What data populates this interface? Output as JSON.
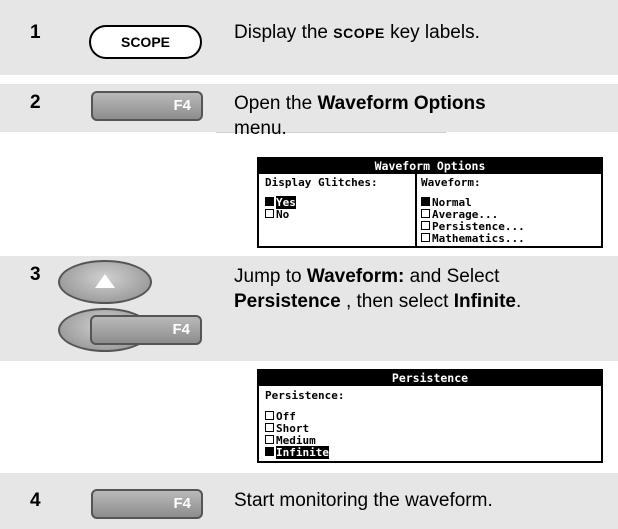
{
  "steps": [
    {
      "number": "1",
      "key_label": "SCOPE",
      "text_pre": "Display the ",
      "text_key": "SCOPE",
      "text_post": " key labels."
    },
    {
      "number": "2",
      "key_label": "F4",
      "text_pre": "Open the ",
      "text_bold": "Waveform Options",
      "text_post": "menu.",
      "menu": {
        "title": "Waveform Options",
        "col1_header": "Display Glitches:",
        "col1_items": [
          {
            "label": "Yes",
            "selected": true
          },
          {
            "label": "No",
            "selected": false
          }
        ],
        "col2_header": "Waveform:",
        "col2_items": [
          {
            "label": "Normal",
            "selected": true
          },
          {
            "label": "Average...",
            "selected": false
          },
          {
            "label": "Persistence...",
            "selected": false
          },
          {
            "label": "Mathematics...",
            "selected": false
          }
        ]
      }
    },
    {
      "number": "3",
      "key_label": "F4",
      "line1_pre": "Jump to ",
      "line1_bold": "Waveform:",
      "line1_post": " and Select",
      "line2_bold1": "Persistence",
      "line2_mid": " , then select ",
      "line2_bold2": "Infinite",
      "line2_end": ".",
      "menu": {
        "title": "Persistence",
        "header": "Persistence:",
        "items": [
          {
            "label": "Off",
            "selected": false
          },
          {
            "label": "Short",
            "selected": false
          },
          {
            "label": "Medium",
            "selected": false
          },
          {
            "label": "Infinite",
            "selected": true
          }
        ]
      }
    },
    {
      "number": "4",
      "key_label": "F4",
      "text": "Start monitoring the waveform."
    }
  ]
}
